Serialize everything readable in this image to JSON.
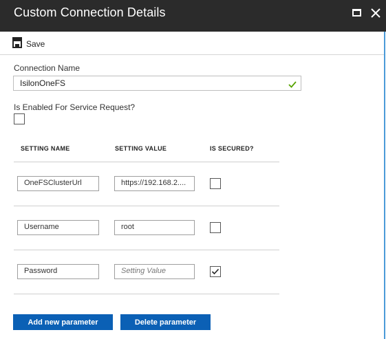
{
  "window": {
    "title": "Custom Connection Details"
  },
  "toolbar": {
    "save_label": "Save"
  },
  "connection_name": {
    "label": "Connection Name",
    "value": "IsilonOneFS"
  },
  "enabled": {
    "label": "Is Enabled For Service Request?",
    "checked": false
  },
  "table": {
    "headers": {
      "name": "SETTING NAME",
      "value": "SETTING VALUE",
      "secured": "IS SECURED?"
    },
    "rows": [
      {
        "name": "OneFSClusterUrl",
        "value": "https://192.168.2....",
        "value_placeholder": "",
        "secured": false
      },
      {
        "name": "Username",
        "value": "root",
        "value_placeholder": "",
        "secured": false
      },
      {
        "name": "Password",
        "value": "",
        "value_placeholder": "Setting Value",
        "secured": true
      }
    ]
  },
  "actions": {
    "add_label": "Add new parameter",
    "delete_label": "Delete parameter"
  },
  "colors": {
    "titlebar": "#2b2b2b",
    "accent": "#0b60b5",
    "success": "#57a300"
  }
}
